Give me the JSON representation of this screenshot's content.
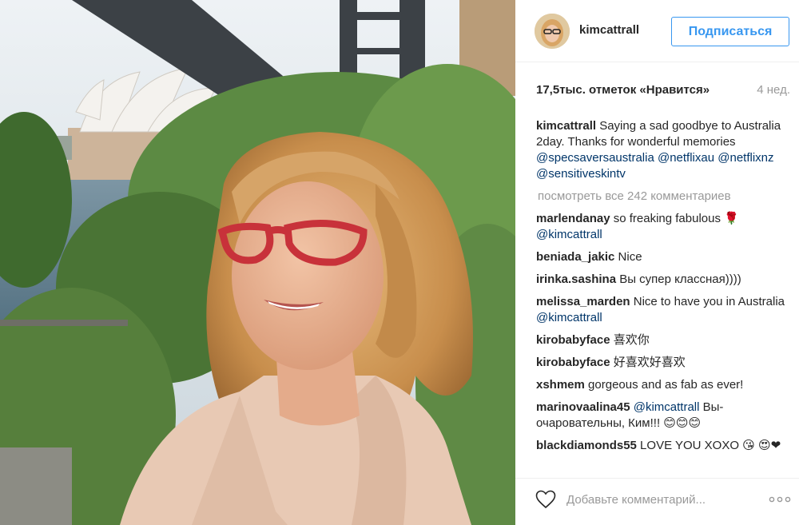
{
  "post": {
    "username": "kimcattrall",
    "follow_label": "Подписаться",
    "likes": "17,5тыс. отметок «Нравится»",
    "age": "4 нед.",
    "caption": {
      "user": "kimcattrall",
      "text": " Saying a sad goodbye to Australia 2day. Thanks for wonderful memories ",
      "mentions": [
        "@specsaversaustralia",
        "@netflixau",
        "@netflixnz",
        "@sensitiveskintv"
      ]
    },
    "view_all": "посмотреть все 242 комментариев"
  },
  "comments": [
    {
      "user": "marlendanay",
      "text": " so freaking fabulous 🌹",
      "mention": "@kimcattrall"
    },
    {
      "user": "beniada_jakic",
      "text": " Nice"
    },
    {
      "user": "irinka.sashina",
      "text": " Вы супер классная))))"
    },
    {
      "user": "melissa_marden",
      "text": " Nice to have you in Australia ",
      "mention": "@kimcattrall"
    },
    {
      "user": "kirobabyface",
      "text": " 喜欢你"
    },
    {
      "user": "kirobabyface",
      "text": " 好喜欢好喜欢"
    },
    {
      "user": "xshmem",
      "text": " gorgeous and as fab as ever!"
    },
    {
      "user": "marinovaalina45",
      "text": " Вы-очаровательны, Ким!!! 😊😊😊",
      "mention": "@kimcattrall"
    },
    {
      "user": "blackdiamonds55",
      "text": " LOVE YOU XOXO 😘 😍❤"
    }
  ],
  "footer": {
    "comment_placeholder": "Добавьте комментарий...",
    "like_icon": "heart-outline-icon",
    "more_icon": "more-options-icon"
  },
  "colors": {
    "accent": "#3897f0",
    "mention": "#003569",
    "muted": "#999999",
    "text": "#262626"
  }
}
